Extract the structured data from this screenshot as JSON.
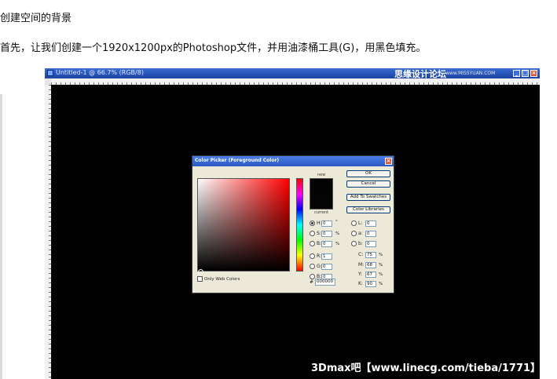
{
  "article": {
    "heading": "创建空间的背景",
    "intro": "首先，让我们创建一个1920x1200px的Photoshop文件，并用油漆桶工具(G)，用黑色填充。"
  },
  "photoshop": {
    "title": "Untitled-1 @ 66.7% (RGB/8)",
    "watermark": "思缘设计论坛",
    "watermark_url": "www.MISSYUAN.COM",
    "canvas_color": "#020202"
  },
  "color_picker": {
    "title": "Color Picker (Foreground Color)",
    "new_label": "new",
    "current_label": "current",
    "buttons": {
      "ok": "OK",
      "cancel": "Cancel",
      "add": "Add To Swatches",
      "libraries": "Color Libraries"
    },
    "hsb": [
      {
        "label": "H:",
        "value": "0",
        "unit": "°"
      },
      {
        "label": "S:",
        "value": "0",
        "unit": "%"
      },
      {
        "label": "B:",
        "value": "0",
        "unit": "%"
      }
    ],
    "rgb": [
      {
        "label": "R:",
        "value": "1"
      },
      {
        "label": "G:",
        "value": "0"
      },
      {
        "label": "B:",
        "value": "0"
      }
    ],
    "lab": [
      {
        "label": "L:",
        "value": "0"
      },
      {
        "label": "a:",
        "value": "0"
      },
      {
        "label": "b:",
        "value": "0"
      }
    ],
    "cmyk": [
      {
        "label": "C:",
        "value": "75",
        "unit": "%"
      },
      {
        "label": "M:",
        "value": "68",
        "unit": "%"
      },
      {
        "label": "Y:",
        "value": "67",
        "unit": "%"
      },
      {
        "label": "K:",
        "value": "90",
        "unit": "%"
      }
    ],
    "hex_label": "#",
    "hex": "000000",
    "web_only": "Only Web Colors"
  },
  "footer_watermark": "3Dmax吧【www.linecg.com/tieba/1771】"
}
